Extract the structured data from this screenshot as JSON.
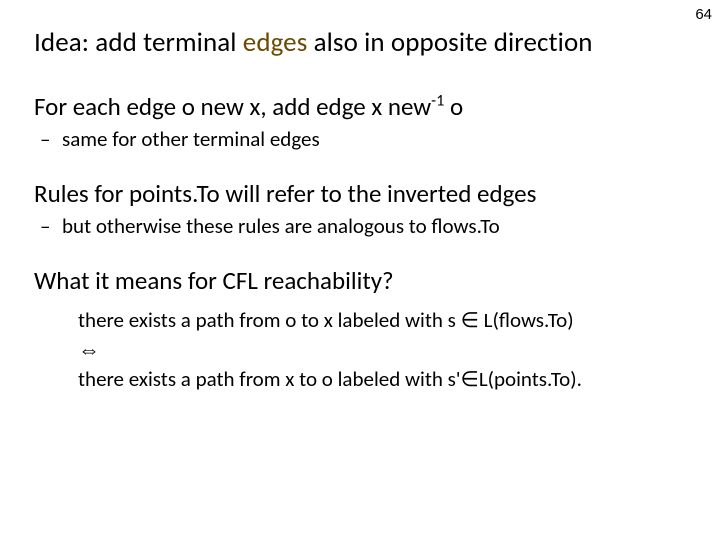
{
  "pageNumber": "64",
  "title_pre": "Idea:  add terminal ",
  "title_edges": "edges",
  "title_post": " also in opposite direction",
  "p1_a": "For each edge o new x, add  edge x new",
  "p1_sup": "-1",
  "p1_b": " o",
  "p1_sub": "same  for other terminal edges",
  "p2": "Rules for points.To will refer to the inverted edges",
  "p2_sub": "but otherwise these rules are analogous to flows.To",
  "p3": "What it means for CFL reachability?",
  "cfl_line1_a": "there exists a path from o to x labeled with s ",
  "cfl_in1": "∈",
  "cfl_line1_b": " L(flows.To)",
  "cfl_iff": "⇔",
  "cfl_line2_a": "there exists a path from x to o labeled with s'",
  "cfl_in2": "∈",
  "cfl_line2_b": "L(points.To)."
}
